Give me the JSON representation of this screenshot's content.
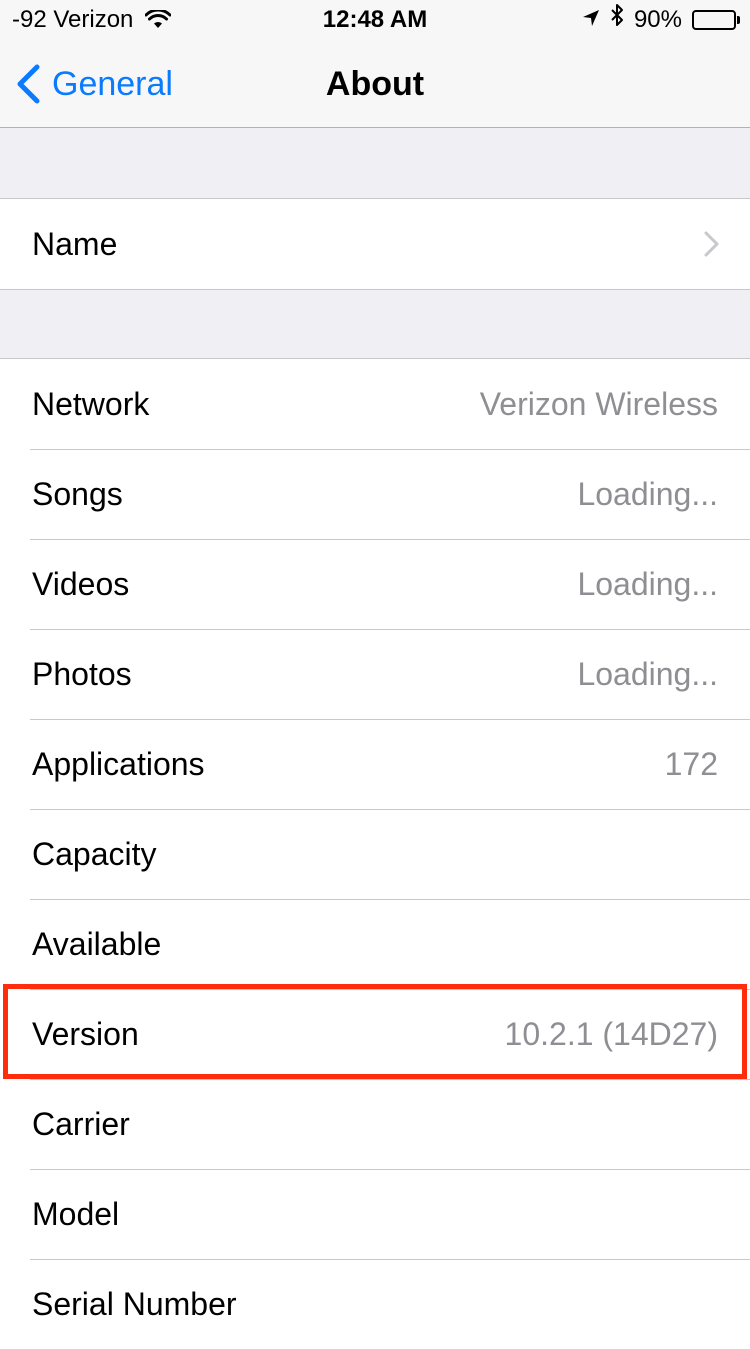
{
  "status_bar": {
    "signal": "-92 Verizon",
    "time": "12:48 AM",
    "battery_percent_text": "90%",
    "battery_level": 0.9
  },
  "nav": {
    "back_label": "General",
    "title": "About"
  },
  "name_row": {
    "label": "Name",
    "value": ""
  },
  "info_rows": [
    {
      "label": "Network",
      "value": "Verizon Wireless"
    },
    {
      "label": "Songs",
      "value": "Loading..."
    },
    {
      "label": "Videos",
      "value": "Loading..."
    },
    {
      "label": "Photos",
      "value": "Loading..."
    },
    {
      "label": "Applications",
      "value": "172"
    },
    {
      "label": "Capacity",
      "value": ""
    },
    {
      "label": "Available",
      "value": ""
    },
    {
      "label": "Version",
      "value": "10.2.1 (14D27)"
    },
    {
      "label": "Carrier",
      "value": ""
    },
    {
      "label": "Model",
      "value": ""
    },
    {
      "label": "Serial Number",
      "value": ""
    }
  ],
  "colors": {
    "accent": "#0a7aff",
    "highlight": "#ff2d0c",
    "secondary_text": "#8e8e93",
    "background": "#efeff4"
  }
}
